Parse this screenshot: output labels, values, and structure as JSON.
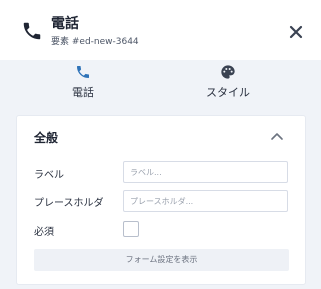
{
  "colors": {
    "accent": "#2f73b8",
    "dark": "#1f2533",
    "panel_bg": "#f0f3f8"
  },
  "header": {
    "icon": "phone-icon",
    "title": "電話",
    "subtitle": "要素 #ed-new-3644",
    "close_icon": "close-icon"
  },
  "tabs": [
    {
      "icon": "phone-icon",
      "label": "電話",
      "active": true
    },
    {
      "icon": "palette-icon",
      "label": "スタイル",
      "active": false
    }
  ],
  "section": {
    "title": "全般",
    "collapse_icon": "chevron-up-icon",
    "fields": {
      "label": {
        "label": "ラベル",
        "placeholder": "ラベル...",
        "value": ""
      },
      "placeholder": {
        "label": "プレースホルダ",
        "placeholder": "プレースホルダ...",
        "value": ""
      },
      "required": {
        "label": "必須",
        "checked": false
      }
    },
    "form_settings_button": "フォーム設定を表示"
  }
}
